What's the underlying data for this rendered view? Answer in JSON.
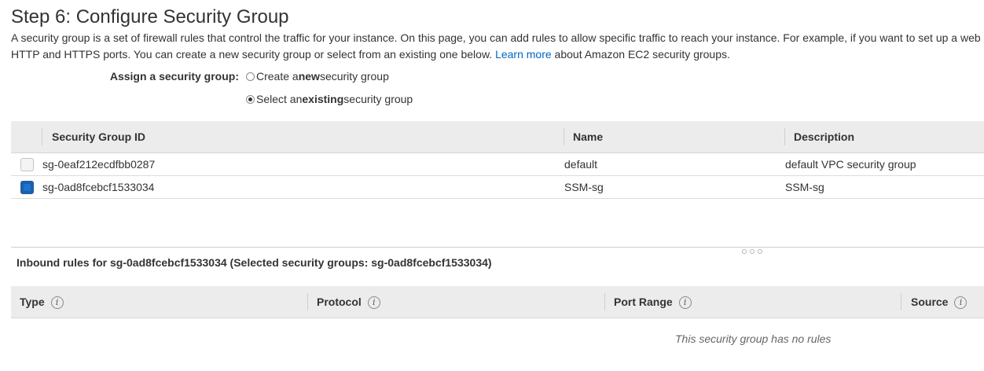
{
  "page": {
    "title": "Step 6: Configure Security Group",
    "intro_line1": "A security group is a set of firewall rules that control the traffic for your instance. On this page, you can add rules to allow specific traffic to reach your instance. For example, if you want to set up a web",
    "intro_line2_pre": "HTTP and HTTPS ports. You can create a new security group or select from an existing one below.",
    "learn_more": "Learn more",
    "intro_line2_post": "about Amazon EC2 security groups."
  },
  "assign": {
    "label": "Assign a security group:",
    "options": [
      {
        "pre": "Create a ",
        "bold": "new",
        "post": " security group",
        "selected": false
      },
      {
        "pre": "Select an ",
        "bold": "existing",
        "post": " security group",
        "selected": true
      }
    ]
  },
  "security_groups": {
    "columns": [
      "Security Group ID",
      "Name",
      "Description"
    ],
    "rows": [
      {
        "id": "sg-0eaf212ecdfbb0287",
        "name": "default",
        "description": "default VPC security group",
        "checked": false
      },
      {
        "id": "sg-0ad8fcebcf1533034",
        "name": "SSM-sg",
        "description": "SSM-sg",
        "checked": true
      }
    ]
  },
  "inbound": {
    "title": "Inbound rules for sg-0ad8fcebcf1533034 (Selected security groups: sg-0ad8fcebcf1533034)",
    "columns": [
      "Type",
      "Protocol",
      "Port Range",
      "Source"
    ],
    "info_icon": "i",
    "empty_message": "This security group has no rules"
  },
  "icons": {
    "info": "info-icon",
    "resize": "resize-handle-icon"
  },
  "colors": {
    "link": "#0066c0",
    "checkbox_selected": "#1f5ea8",
    "header_bg": "#ececec"
  }
}
